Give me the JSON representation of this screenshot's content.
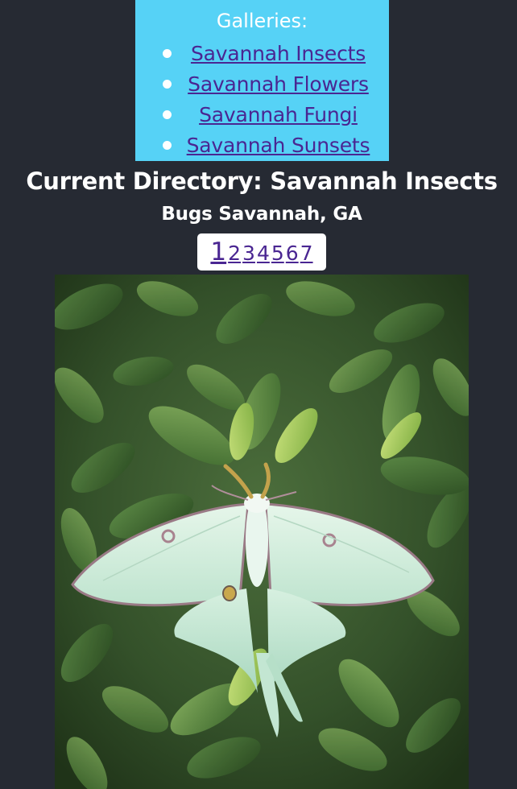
{
  "galleries": {
    "title": "Galleries:",
    "items": [
      {
        "label": "Savannah Insects"
      },
      {
        "label": "Savannah Flowers"
      },
      {
        "label": "Savannah Fungi"
      },
      {
        "label": "Savannah Sunsets"
      }
    ]
  },
  "directory": {
    "heading": "Current Directory: Savannah Insects",
    "subheading": "Bugs Savannah, GA"
  },
  "pagination": {
    "current": "1",
    "pages": [
      "2",
      "3",
      "4",
      "5",
      "6",
      "7"
    ]
  },
  "photo": {
    "subject": "luna-moth-on-azalea-leaves"
  },
  "colors": {
    "background": "#262a33",
    "gallery_box": "#56d2f6",
    "link": "#4a2692",
    "heading_text": "#ffffff"
  }
}
